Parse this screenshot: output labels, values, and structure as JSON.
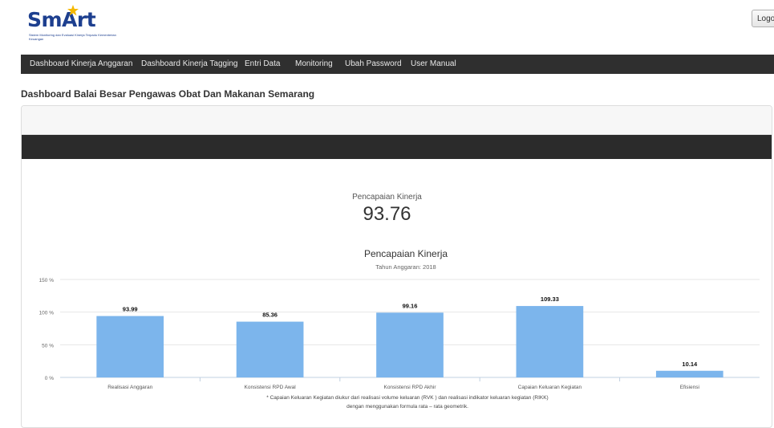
{
  "header": {
    "logo_text": "SmArt",
    "logo_subtitle": "Sistem Monitoring dan Evaluasi Kinerja Terpadu Kementerian Keuangan",
    "logout_label": "Logout"
  },
  "navbar": {
    "items": [
      "Dashboard Kinerja Anggaran",
      "Dashboard Kinerja Tagging",
      "Entri Data",
      "Monitoring",
      "Ubah Password",
      "User Manual"
    ]
  },
  "page": {
    "title": "Dashboard Balai Besar Pengawas Obat Dan Makanan Semarang"
  },
  "score": {
    "label": "Pencapaian Kinerja",
    "value": "93.76"
  },
  "colors": {
    "bar": "#7cb5ec",
    "navbar": "#2f2f2f",
    "dark_band": "#2b2b2b"
  },
  "chart_data": {
    "type": "bar",
    "title": "Pencapaian Kinerja",
    "subtitle": "Tahun Anggaran: 2018",
    "categories": [
      "Realisasi Anggaran",
      "Konsistensi RPD Awal",
      "Konsistensi RPD Akhir",
      "Capaian Keluaran Kegiatan",
      "Efisiensi"
    ],
    "values": [
      93.99,
      85.36,
      99.16,
      109.33,
      10.14
    ],
    "data_labels": [
      "93.99",
      "85.36",
      "99.16",
      "109.33",
      "10.14"
    ],
    "ylim": [
      0,
      150
    ],
    "y_ticks": [
      0,
      50,
      100,
      150
    ],
    "y_tick_labels": [
      "0 %",
      "50 %",
      "100 %",
      "150 %"
    ],
    "grid": true,
    "legend": "none",
    "footnote_line1": "* Capaian Keluaran Kegiatan diukur dari realisasi volume keluaran (RVK ) dan realisasi indikator keluaran kegiatan (RIKK)",
    "footnote_line2": "dengan menggunakan formula rata – rata geometrik."
  }
}
